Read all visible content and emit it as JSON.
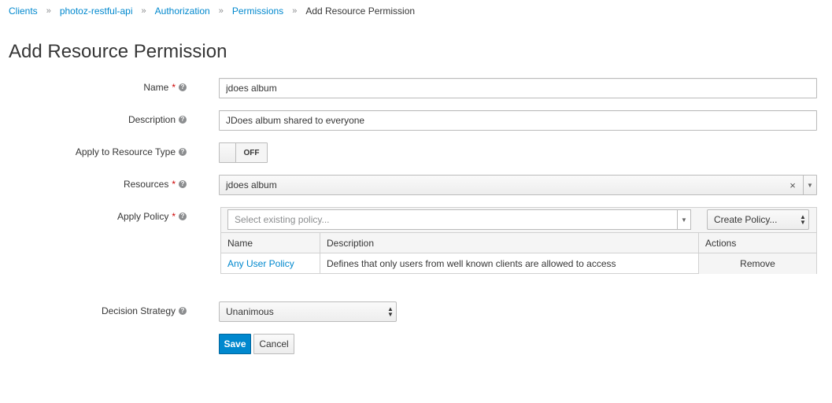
{
  "breadcrumb": {
    "items": [
      "Clients",
      "photoz-restful-api",
      "Authorization",
      "Permissions"
    ],
    "separator": "»",
    "current": "Add Resource Permission"
  },
  "page_title": "Add Resource Permission",
  "form": {
    "name": {
      "label": "Name",
      "required_mark": "*",
      "value": "jdoes album"
    },
    "description": {
      "label": "Description",
      "value": "JDoes album shared to everyone"
    },
    "apply_resource_type": {
      "label": "Apply to Resource Type",
      "state": "OFF"
    },
    "resources": {
      "label": "Resources",
      "required_mark": "*",
      "value": "jdoes album",
      "clear_glyph": "×"
    },
    "apply_policy": {
      "label": "Apply Policy",
      "required_mark": "*",
      "placeholder": "Select existing policy...",
      "create_button": "Create Policy...",
      "table": {
        "headers": [
          "Name",
          "Description",
          "Actions"
        ],
        "rows": [
          {
            "name": "Any User Policy",
            "description": "Defines that only users from well known clients are allowed to access",
            "action": "Remove"
          }
        ]
      }
    },
    "decision_strategy": {
      "label": "Decision Strategy",
      "value": "Unanimous"
    }
  },
  "buttons": {
    "save": "Save",
    "cancel": "Cancel"
  },
  "colors": {
    "link": "#0088ce",
    "primary": "#0088ce",
    "required": "#cc0000"
  }
}
